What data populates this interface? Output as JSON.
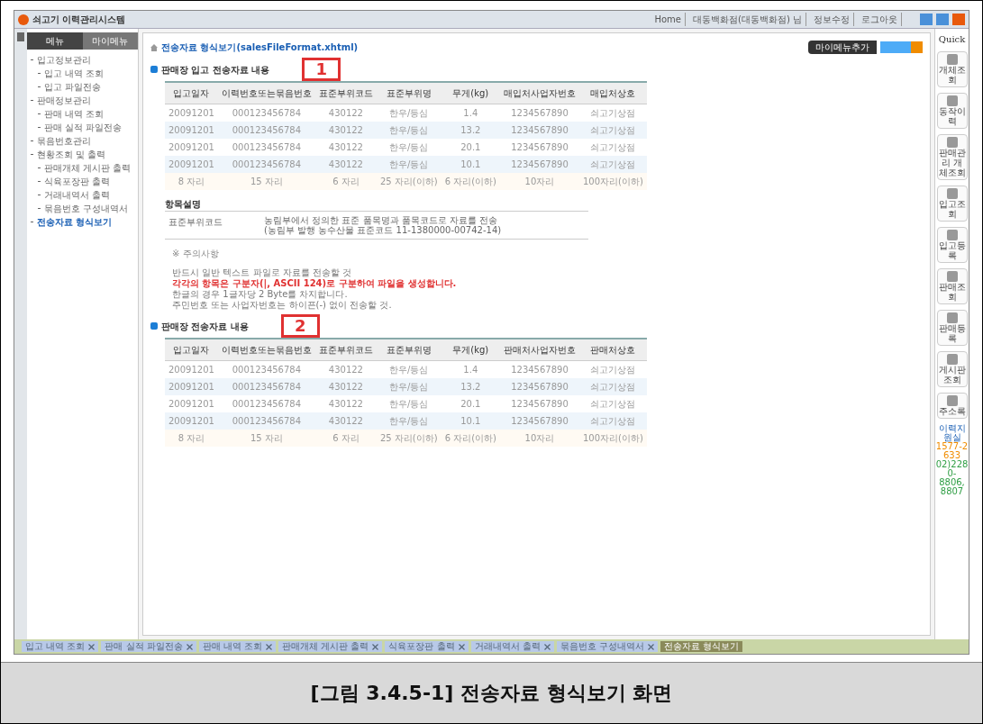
{
  "window": {
    "title": "쇠고기 이력관리시스템",
    "top_links": [
      "Home",
      "대동백화점(대동백화점) 님",
      "정보수정",
      "로그아웃"
    ]
  },
  "sidebar": {
    "tabs": [
      {
        "label": "메뉴",
        "selected": true
      },
      {
        "label": "마이메뉴",
        "selected": false
      }
    ],
    "items": [
      {
        "label": "입고정보관리",
        "selected": false,
        "children": [
          {
            "label": "입고 내역 조회",
            "selected": false
          },
          {
            "label": "입고 파일전송",
            "selected": false
          }
        ]
      },
      {
        "label": "판매정보관리",
        "selected": false,
        "children": [
          {
            "label": "판매 내역 조회",
            "selected": false
          },
          {
            "label": "판매 실적 파일전송",
            "selected": false
          }
        ]
      },
      {
        "label": "묶음번호관리",
        "selected": false
      },
      {
        "label": "현황조회 및 출력",
        "selected": false,
        "children": [
          {
            "label": "판매개체 게시판 출력",
            "selected": false
          },
          {
            "label": "식육포장판 출력",
            "selected": false
          },
          {
            "label": "거래내역서 출력",
            "selected": false
          },
          {
            "label": "묶음번호 구성내역서",
            "selected": false
          }
        ]
      },
      {
        "label": "전송자료 형식보기",
        "selected": true
      }
    ]
  },
  "breadcrumb": "전송자료 형식보기(salesFileFormat.xhtml)",
  "toolbar": {
    "add_label": "마이메뉴추가"
  },
  "sections": [
    {
      "title": "판매장 입고 전송자료 내용",
      "marker": "1",
      "columns": [
        "입고일자",
        "이력번호또는묶음번호",
        "표준부위코드",
        "표준부위명",
        "무게(kg)",
        "매입처사업자번호",
        "매입처상호"
      ],
      "rows": [
        [
          "20091201",
          "000123456784",
          "430122",
          "한우/등심",
          "1.4",
          "1234567890",
          "쇠고기상점"
        ],
        [
          "20091201",
          "000123456784",
          "430122",
          "한우/등심",
          "13.2",
          "1234567890",
          "쇠고기상점"
        ],
        [
          "20091201",
          "000123456784",
          "430122",
          "한우/등심",
          "20.1",
          "1234567890",
          "쇠고기상점"
        ],
        [
          "20091201",
          "000123456784",
          "430122",
          "한우/등심",
          "10.1",
          "1234567890",
          "쇠고기상점"
        ]
      ],
      "footer": [
        "8 자리",
        "15 자리",
        "6 자리",
        "25 자리(이하)",
        "6 자리(이하)",
        "10자리",
        "100자리(이하)"
      ]
    },
    {
      "title": "판매장 전송자료 내용",
      "marker": "2",
      "columns": [
        "입고일자",
        "이력번호또는묶음번호",
        "표준부위코드",
        "표준부위명",
        "무게(kg)",
        "판매처사업자번호",
        "판매처상호"
      ],
      "rows": [
        [
          "20091201",
          "000123456784",
          "430122",
          "한우/등심",
          "1.4",
          "1234567890",
          "쇠고기상점"
        ],
        [
          "20091201",
          "000123456784",
          "430122",
          "한우/등심",
          "13.2",
          "1234567890",
          "쇠고기상점"
        ],
        [
          "20091201",
          "000123456784",
          "430122",
          "한우/등심",
          "20.1",
          "1234567890",
          "쇠고기상점"
        ],
        [
          "20091201",
          "000123456784",
          "430122",
          "한우/등심",
          "10.1",
          "1234567890",
          "쇠고기상점"
        ]
      ],
      "footer": [
        "8 자리",
        "15 자리",
        "6 자리",
        "25 자리(이하)",
        "6 자리(이하)",
        "10자리",
        "100자리(이하)"
      ]
    }
  ],
  "description": {
    "title": "항목설명",
    "term": "표준부위코드",
    "lines": [
      "농림부에서 정의한 표준 품목명과 품목코드로 자료를 전송",
      "(농림부 발행 농수산물 표준코드 11-1380000-00742-14)"
    ]
  },
  "notes": {
    "title": "※ 주의사항",
    "lines": [
      {
        "text": "반드시 일반 텍스트 파일로 자료를 전송할 것",
        "kind": "normal"
      },
      {
        "text": "각각의 항목은 구분자(|, ASCII 124)로 구분하여 파일을 생성합니다.",
        "kind": "warning"
      },
      {
        "text": "한글의 경우 1글자당 2 Byte를 차지합니다.",
        "kind": "normal"
      },
      {
        "text": "주민번호 또는 사업자번호는 하이픈(-) 없이 전송할 것.",
        "kind": "normal"
      }
    ]
  },
  "quick": {
    "title": "Quick",
    "items": [
      "개체조회",
      "동작이력",
      "판매관리 개체조회",
      "입고조회",
      "입고등록",
      "판매조회",
      "판매등록",
      "게시판 조회",
      "주소록"
    ],
    "contact": [
      "이력지원실",
      "1577-2633",
      "02)2280-",
      "8806, 8807"
    ]
  },
  "bottom_tabs": [
    {
      "label": "입고 내역 조회",
      "selected": false
    },
    {
      "label": "판매 실적 파일전송",
      "selected": false
    },
    {
      "label": "판매 내역 조회",
      "selected": false
    },
    {
      "label": "판매개체 게시판 출력",
      "selected": false
    },
    {
      "label": "식육포장판 출력",
      "selected": false
    },
    {
      "label": "거래내역서 출력",
      "selected": false
    },
    {
      "label": "묶음번호 구성내역서",
      "selected": false
    },
    {
      "label": "전송자료 형식보기",
      "selected": true
    }
  ],
  "caption": "[그림 3.4.5-1] 전송자료 형식보기 화면"
}
